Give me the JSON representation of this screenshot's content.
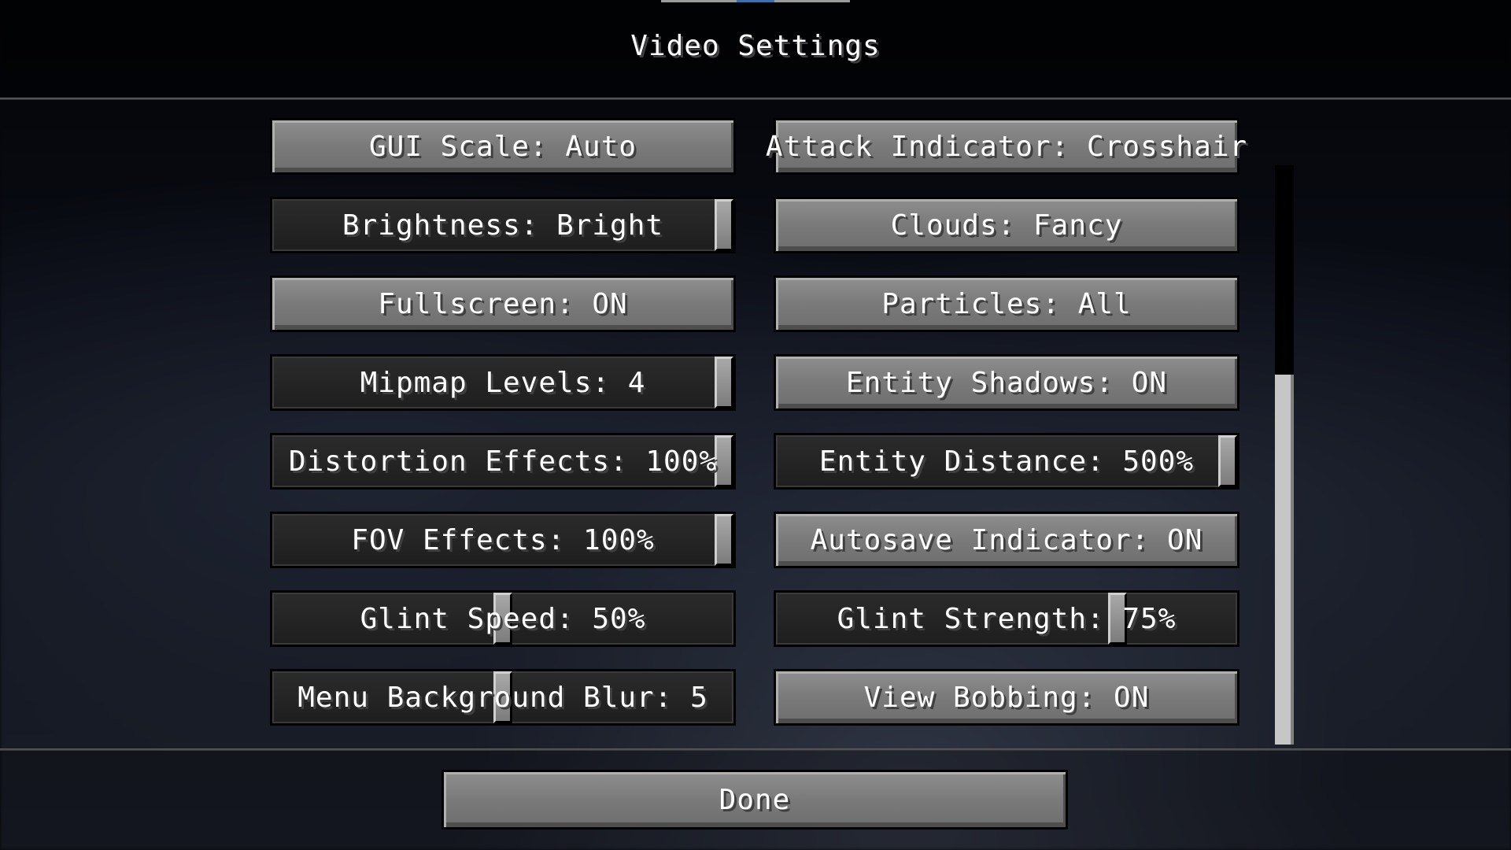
{
  "screen": {
    "title": "Video Settings"
  },
  "options": [
    {
      "label": "GUI Scale: Auto",
      "kind": "button"
    },
    {
      "label": "Attack Indicator: Crosshair",
      "kind": "button"
    },
    {
      "label": "Brightness: Bright",
      "kind": "slider",
      "value": 1.0
    },
    {
      "label": "Clouds: Fancy",
      "kind": "button"
    },
    {
      "label": "Fullscreen: ON",
      "kind": "button"
    },
    {
      "label": "Particles: All",
      "kind": "button"
    },
    {
      "label": "Mipmap Levels: 4",
      "kind": "slider",
      "value": 1.0
    },
    {
      "label": "Entity Shadows: ON",
      "kind": "button"
    },
    {
      "label": "Distortion Effects: 100%",
      "kind": "slider",
      "value": 1.0
    },
    {
      "label": "Entity Distance: 500%",
      "kind": "slider",
      "value": 1.0
    },
    {
      "label": "FOV Effects: 100%",
      "kind": "slider",
      "value": 1.0
    },
    {
      "label": "Autosave Indicator: ON",
      "kind": "button"
    },
    {
      "label": "Glint Speed: 50%",
      "kind": "slider",
      "value": 0.5
    },
    {
      "label": "Glint Strength: 75%",
      "kind": "slider",
      "value": 0.75
    },
    {
      "label": "Menu Background Blur: 5",
      "kind": "slider",
      "value": 0.5
    },
    {
      "label": "View Bobbing: ON",
      "kind": "button"
    }
  ],
  "footer": {
    "done_label": "Done"
  },
  "scroll": {
    "position": 0.45
  }
}
